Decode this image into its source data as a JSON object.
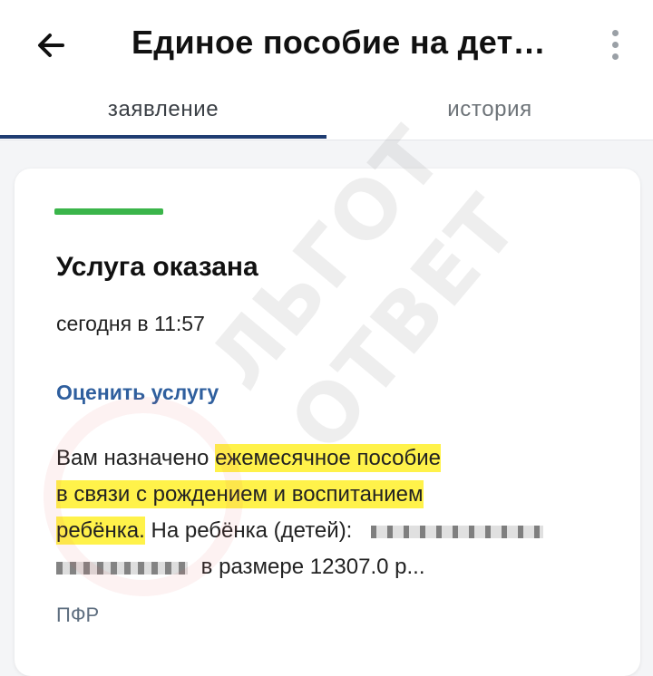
{
  "header": {
    "back_icon": "arrow-left-icon",
    "title": "Единое пособие на дет…",
    "menu_icon": "more-vertical-icon"
  },
  "tabs": [
    {
      "label": "заявление",
      "active": true
    },
    {
      "label": "история",
      "active": false
    }
  ],
  "card": {
    "status_color": "#3ab54a",
    "status": "Услуга оказана",
    "time": "сегодня в 11:57",
    "rate_link": "Оценить услугу",
    "message": {
      "prefix": "Вам назначено",
      "highlight_1": "ежемесячное пособие",
      "highlight_2": "в связи с рождением и воспитанием",
      "highlight_3": "ребёнка.",
      "after": "На ребёнка (детей):",
      "tail": "в размере 12307.0 р..."
    },
    "source": "ПФР"
  },
  "watermark": {
    "line_1": "ЛЬГОТ",
    "line_2": "ОТВЕТ"
  }
}
